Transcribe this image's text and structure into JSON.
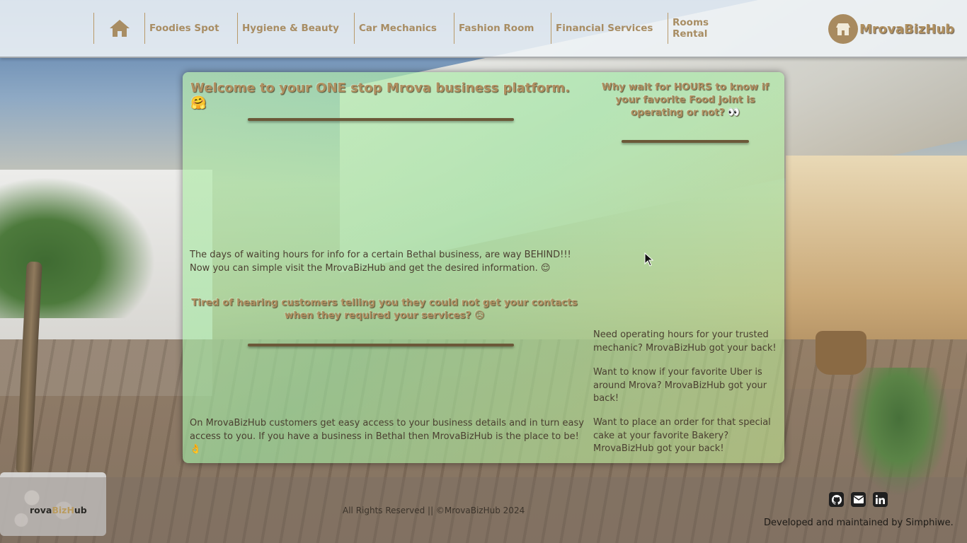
{
  "nav": {
    "home_icon": "home-icon",
    "items": [
      {
        "label": "Foodies Spot"
      },
      {
        "label": "Hygiene & Beauty"
      },
      {
        "label": "Car Mechanics"
      },
      {
        "label": "Fashion Room"
      },
      {
        "label": "Financial Services"
      },
      {
        "label": "Rooms Rental"
      }
    ],
    "logo": {
      "prefix": "M",
      "name": "rovaBizHub",
      "icon": "shop-icon"
    }
  },
  "main": {
    "welcome": "Welcome to your ONE stop Mrova business platform. 🤗",
    "days_paragraph": "The days of waiting hours for info for a certain Bethal business, are way BEHIND!!! Now you can simple visit the MrovaBizHub and get the desired information. 😌",
    "tired_heading": "Tired of hearing customers telling you they could not get your contacts when they required your services? 😥",
    "access_paragraph": "On MrovaBizHub customers get easy access to your business details and in turn easy access to you. If you have a business in Bethal then MrovaBizHub is the place to be! 👌"
  },
  "side": {
    "heading": "Why wait for HOURS to know if your favorite Food joint is operating or not? 👀",
    "mechanic": "Need operating hours for your trusted mechanic? MrovaBizHub got your back!",
    "uber": "Want to know if your favorite Uber is around Mrova? MrovaBizHub got your back!",
    "cake": "Want to place an order for that special cake at your favorite Bakery? MrovaBizHub got your back!"
  },
  "footer": {
    "logo_parts": [
      "rova",
      "Biz",
      "H",
      "ub"
    ],
    "rights": "All Rights Reserved || ©MrovaBizHub 2024",
    "developer": "Developed and maintained by Simphiwe.",
    "socials": [
      "github-icon",
      "mail-icon",
      "linkedin-icon"
    ]
  },
  "colors": {
    "accent": "#a88d63",
    "panel": "#b6e8aa",
    "divider": "#6b5838"
  }
}
